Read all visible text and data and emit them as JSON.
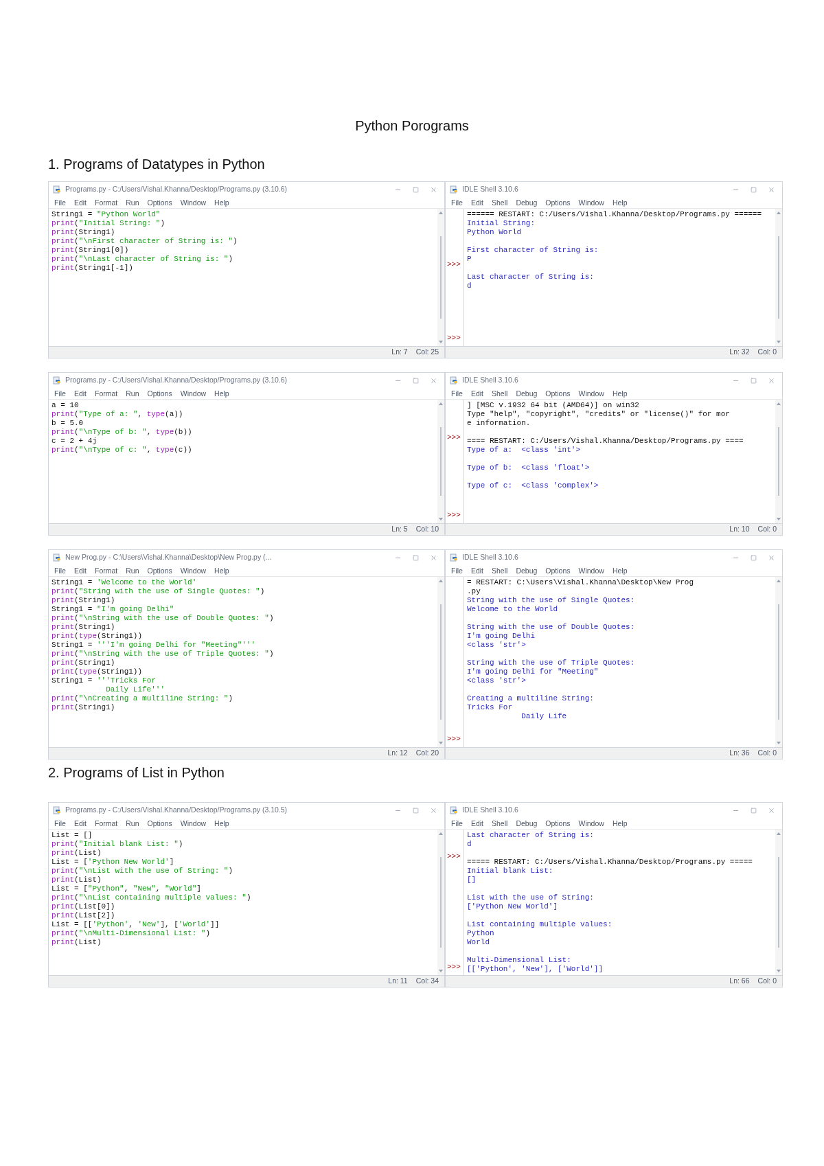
{
  "heading": "Python Porograms",
  "sections": [
    {
      "title": "1. Programs of Datatypes in Python",
      "rows": [
        {
          "editor": {
            "title": "Programs.py - C:/Users/Vishal.Khanna/Desktop/Programs.py (3.10.6)",
            "menu": [
              "File",
              "Edit",
              "Format",
              "Run",
              "Options",
              "Window",
              "Help"
            ],
            "lines": [
              [
                {
                  "kind": "plain",
                  "text": "String1 = "
                },
                {
                  "kind": "str",
                  "text": "\"Python World\""
                }
              ],
              [
                {
                  "kind": "kw",
                  "text": "print"
                },
                {
                  "kind": "plain",
                  "text": "("
                },
                {
                  "kind": "str",
                  "text": "\"Initial String: \""
                },
                {
                  "kind": "plain",
                  "text": ")"
                }
              ],
              [
                {
                  "kind": "kw",
                  "text": "print"
                },
                {
                  "kind": "plain",
                  "text": "(String1)"
                }
              ],
              [
                {
                  "kind": "kw",
                  "text": "print"
                },
                {
                  "kind": "plain",
                  "text": "("
                },
                {
                  "kind": "str",
                  "text": "\"\\nFirst character of String is: \""
                },
                {
                  "kind": "plain",
                  "text": ")"
                }
              ],
              [
                {
                  "kind": "kw",
                  "text": "print"
                },
                {
                  "kind": "plain",
                  "text": "(String1[0])"
                }
              ],
              [
                {
                  "kind": "kw",
                  "text": "print"
                },
                {
                  "kind": "plain",
                  "text": "("
                },
                {
                  "kind": "str",
                  "text": "\"\\nLast character of String is: \""
                },
                {
                  "kind": "plain",
                  "text": ")"
                }
              ],
              [
                {
                  "kind": "kw",
                  "text": "print"
                },
                {
                  "kind": "plain",
                  "text": "(String1[-1])"
                }
              ]
            ],
            "status": {
              "line": "Ln: 7",
              "col": "Col: 25"
            }
          },
          "shell": {
            "title": "IDLE Shell 3.10.6",
            "menu": [
              "File",
              "Edit",
              "Shell",
              "Debug",
              "Options",
              "Window",
              "Help"
            ],
            "lines": [
              {
                "kind": "restart",
                "text": "====== RESTART: C:/Users/Vishal.Khanna/Desktop/Programs.py ======"
              },
              {
                "kind": "output",
                "text": "Initial String:"
              },
              {
                "kind": "output",
                "text": "Python World"
              },
              {
                "kind": "blank"
              },
              {
                "kind": "output",
                "text": "First character of String is:"
              },
              {
                "kind": "output",
                "text": "P",
                "prompt": ">>>"
              },
              {
                "kind": "blank"
              },
              {
                "kind": "output",
                "text": "Last character of String is:"
              },
              {
                "kind": "output",
                "text": "d"
              }
            ],
            "final_prompt": ">>>",
            "status": {
              "line": "Ln: 32",
              "col": "Col: 0"
            }
          }
        },
        {
          "editor": {
            "title": "Programs.py - C:/Users/Vishal.Khanna/Desktop/Programs.py (3.10.6)",
            "menu": [
              "File",
              "Edit",
              "Format",
              "Run",
              "Options",
              "Window",
              "Help"
            ],
            "lines": [
              [
                {
                  "kind": "plain",
                  "text": "a = 10"
                }
              ],
              [
                {
                  "kind": "kw",
                  "text": "print"
                },
                {
                  "kind": "plain",
                  "text": "("
                },
                {
                  "kind": "str",
                  "text": "\"Type of a: \""
                },
                {
                  "kind": "plain",
                  "text": ", "
                },
                {
                  "kind": "kw",
                  "text": "type"
                },
                {
                  "kind": "plain",
                  "text": "(a))"
                }
              ],
              [
                {
                  "kind": "plain",
                  "text": "b = 5.0"
                }
              ],
              [
                {
                  "kind": "kw",
                  "text": "print"
                },
                {
                  "kind": "plain",
                  "text": "("
                },
                {
                  "kind": "str",
                  "text": "\"\\nType of b: \""
                },
                {
                  "kind": "plain",
                  "text": ", "
                },
                {
                  "kind": "kw",
                  "text": "type"
                },
                {
                  "kind": "plain",
                  "text": "(b))"
                }
              ],
              [
                {
                  "kind": "plain",
                  "text": "c = 2 + 4j"
                }
              ],
              [
                {
                  "kind": "kw",
                  "text": "print"
                },
                {
                  "kind": "plain",
                  "text": "("
                },
                {
                  "kind": "str",
                  "text": "\"\\nType of c: \""
                },
                {
                  "kind": "plain",
                  "text": ", "
                },
                {
                  "kind": "kw",
                  "text": "type"
                },
                {
                  "kind": "plain",
                  "text": "(c))"
                }
              ]
            ],
            "status": {
              "line": "Ln: 5",
              "col": "Col: 10"
            }
          },
          "shell": {
            "title": "IDLE Shell 3.10.6",
            "menu": [
              "File",
              "Edit",
              "Shell",
              "Debug",
              "Options",
              "Window",
              "Help"
            ],
            "lines": [
              {
                "kind": "info",
                "text": "] [MSC v.1932 64 bit (AMD64)] on win32"
              },
              {
                "kind": "info",
                "text": "Type \"help\", \"copyright\", \"credits\" or \"license()\" for mor"
              },
              {
                "kind": "info",
                "text": "e information."
              },
              {
                "kind": "blank",
                "prompt": ">>>"
              },
              {
                "kind": "restart",
                "text": "==== RESTART: C:/Users/Vishal.Khanna/Desktop/Programs.py ===="
              },
              {
                "kind": "output",
                "text": "Type of a:  <class 'int'>"
              },
              {
                "kind": "blank"
              },
              {
                "kind": "output",
                "text": "Type of b:  <class 'float'>"
              },
              {
                "kind": "blank"
              },
              {
                "kind": "output",
                "text": "Type of c:  <class 'complex'>"
              }
            ],
            "final_prompt": ">>>",
            "status": {
              "line": "Ln: 10",
              "col": "Col: 0"
            }
          }
        },
        {
          "editor": {
            "title": "New Prog.py - C:\\Users\\Vishal.Khanna\\Desktop\\New Prog.py (...",
            "menu": [
              "File",
              "Edit",
              "Format",
              "Run",
              "Options",
              "Window",
              "Help"
            ],
            "lines": [
              [
                {
                  "kind": "plain",
                  "text": "String1 = "
                },
                {
                  "kind": "str",
                  "text": "'Welcome to the World'"
                }
              ],
              [
                {
                  "kind": "kw",
                  "text": "print"
                },
                {
                  "kind": "plain",
                  "text": "("
                },
                {
                  "kind": "str",
                  "text": "\"String with the use of Single Quotes: \""
                },
                {
                  "kind": "plain",
                  "text": ")"
                }
              ],
              [
                {
                  "kind": "kw",
                  "text": "print"
                },
                {
                  "kind": "plain",
                  "text": "(String1)"
                }
              ],
              [
                {
                  "kind": "plain",
                  "text": "String1 = "
                },
                {
                  "kind": "str",
                  "text": "\"I'm going Delhi\""
                }
              ],
              [
                {
                  "kind": "kw",
                  "text": "print"
                },
                {
                  "kind": "plain",
                  "text": "("
                },
                {
                  "kind": "str",
                  "text": "\"\\nString with the use of Double Quotes: \""
                },
                {
                  "kind": "plain",
                  "text": ")"
                }
              ],
              [
                {
                  "kind": "kw",
                  "text": "print"
                },
                {
                  "kind": "plain",
                  "text": "(String1)"
                }
              ],
              [
                {
                  "kind": "kw",
                  "text": "print"
                },
                {
                  "kind": "plain",
                  "text": "("
                },
                {
                  "kind": "kw",
                  "text": "type"
                },
                {
                  "kind": "plain",
                  "text": "(String1))"
                }
              ],
              [
                {
                  "kind": "plain",
                  "text": "String1 = "
                },
                {
                  "kind": "str",
                  "text": "'''I'm going Delhi for \"Meeting\"'''"
                }
              ],
              [
                {
                  "kind": "kw",
                  "text": "print"
                },
                {
                  "kind": "plain",
                  "text": "("
                },
                {
                  "kind": "str",
                  "text": "\"\\nString with the use of Triple Quotes: \""
                },
                {
                  "kind": "plain",
                  "text": ")"
                }
              ],
              [
                {
                  "kind": "kw",
                  "text": "print"
                },
                {
                  "kind": "plain",
                  "text": "(String1)"
                }
              ],
              [
                {
                  "kind": "kw",
                  "text": "print"
                },
                {
                  "kind": "plain",
                  "text": "("
                },
                {
                  "kind": "kw",
                  "text": "type"
                },
                {
                  "kind": "plain",
                  "text": "(String1))"
                }
              ],
              [
                {
                  "kind": "plain",
                  "text": "String1 = "
                },
                {
                  "kind": "str",
                  "text": "'''Tricks For"
                }
              ],
              [
                {
                  "kind": "str",
                  "text": "            Daily Life'''"
                }
              ],
              [
                {
                  "kind": "kw",
                  "text": "print"
                },
                {
                  "kind": "plain",
                  "text": "("
                },
                {
                  "kind": "str",
                  "text": "\"\\nCreating a multiline String: \""
                },
                {
                  "kind": "plain",
                  "text": ")"
                }
              ],
              [
                {
                  "kind": "kw",
                  "text": "print"
                },
                {
                  "kind": "plain",
                  "text": "(String1)"
                }
              ]
            ],
            "status": {
              "line": "Ln: 12",
              "col": "Col: 20"
            }
          },
          "shell": {
            "title": "IDLE Shell 3.10.6",
            "menu": [
              "File",
              "Edit",
              "Shell",
              "Debug",
              "Options",
              "Window",
              "Help"
            ],
            "lines": [
              {
                "kind": "restart",
                "text": "= RESTART: C:\\Users\\Vishal.Khanna\\Desktop\\New Prog"
              },
              {
                "kind": "restart",
                "text": ".py"
              },
              {
                "kind": "output",
                "text": "String with the use of Single Quotes:"
              },
              {
                "kind": "output",
                "text": "Welcome to the World"
              },
              {
                "kind": "blank"
              },
              {
                "kind": "output",
                "text": "String with the use of Double Quotes:"
              },
              {
                "kind": "output",
                "text": "I'm going Delhi"
              },
              {
                "kind": "output",
                "text": "<class 'str'>"
              },
              {
                "kind": "blank"
              },
              {
                "kind": "output",
                "text": "String with the use of Triple Quotes:"
              },
              {
                "kind": "output",
                "text": "I'm going Delhi for \"Meeting\""
              },
              {
                "kind": "output",
                "text": "<class 'str'>"
              },
              {
                "kind": "blank"
              },
              {
                "kind": "output",
                "text": "Creating a multiline String:"
              },
              {
                "kind": "output",
                "text": "Tricks For"
              },
              {
                "kind": "output",
                "text": "            Daily Life"
              }
            ],
            "final_prompt": ">>>",
            "status": {
              "line": "Ln: 36",
              "col": "Col: 0"
            }
          }
        }
      ]
    },
    {
      "title": "2. Programs of List in Python",
      "rows": [
        {
          "editor": {
            "title": "Programs.py - C:/Users/Vishal.Khanna/Desktop/Programs.py (3.10.5)",
            "menu": [
              "File",
              "Edit",
              "Format",
              "Run",
              "Options",
              "Window",
              "Help"
            ],
            "lines": [
              [
                {
                  "kind": "plain",
                  "text": "List = []"
                }
              ],
              [
                {
                  "kind": "kw",
                  "text": "print"
                },
                {
                  "kind": "plain",
                  "text": "("
                },
                {
                  "kind": "str",
                  "text": "\"Initial blank List: \""
                },
                {
                  "kind": "plain",
                  "text": ")"
                }
              ],
              [
                {
                  "kind": "kw",
                  "text": "print"
                },
                {
                  "kind": "plain",
                  "text": "(List)"
                }
              ],
              [
                {
                  "kind": "plain",
                  "text": "List = ["
                },
                {
                  "kind": "str",
                  "text": "'Python New World'"
                },
                {
                  "kind": "plain",
                  "text": "]"
                }
              ],
              [
                {
                  "kind": "kw",
                  "text": "print"
                },
                {
                  "kind": "plain",
                  "text": "("
                },
                {
                  "kind": "str",
                  "text": "\"\\nList with the use of String: \""
                },
                {
                  "kind": "plain",
                  "text": ")"
                }
              ],
              [
                {
                  "kind": "kw",
                  "text": "print"
                },
                {
                  "kind": "plain",
                  "text": "(List)"
                }
              ],
              [
                {
                  "kind": "plain",
                  "text": "List = ["
                },
                {
                  "kind": "str",
                  "text": "\"Python\""
                },
                {
                  "kind": "plain",
                  "text": ", "
                },
                {
                  "kind": "str",
                  "text": "\"New\""
                },
                {
                  "kind": "plain",
                  "text": ", "
                },
                {
                  "kind": "str",
                  "text": "\"World\""
                },
                {
                  "kind": "plain",
                  "text": "]"
                }
              ],
              [
                {
                  "kind": "kw",
                  "text": "print"
                },
                {
                  "kind": "plain",
                  "text": "("
                },
                {
                  "kind": "str",
                  "text": "\"\\nList containing multiple values: \""
                },
                {
                  "kind": "plain",
                  "text": ")"
                }
              ],
              [
                {
                  "kind": "kw",
                  "text": "print"
                },
                {
                  "kind": "plain",
                  "text": "(List[0])"
                }
              ],
              [
                {
                  "kind": "kw",
                  "text": "print"
                },
                {
                  "kind": "plain",
                  "text": "(List[2])"
                }
              ],
              [
                {
                  "kind": "plain",
                  "text": "List = [["
                },
                {
                  "kind": "str",
                  "text": "'Python'"
                },
                {
                  "kind": "plain",
                  "text": ", "
                },
                {
                  "kind": "str",
                  "text": "'New'"
                },
                {
                  "kind": "plain",
                  "text": "], ["
                },
                {
                  "kind": "str",
                  "text": "'World'"
                },
                {
                  "kind": "plain",
                  "text": "]]"
                }
              ],
              [
                {
                  "kind": "kw",
                  "text": "print"
                },
                {
                  "kind": "plain",
                  "text": "("
                },
                {
                  "kind": "str",
                  "text": "\"\\nMulti-Dimensional List: \""
                },
                {
                  "kind": "plain",
                  "text": ")"
                }
              ],
              [
                {
                  "kind": "kw",
                  "text": "print"
                },
                {
                  "kind": "plain",
                  "text": "(List)"
                }
              ]
            ],
            "status": {
              "line": "Ln: 11",
              "col": "Col: 34"
            }
          },
          "shell": {
            "title": "IDLE Shell 3.10.6",
            "menu": [
              "File",
              "Edit",
              "Shell",
              "Debug",
              "Options",
              "Window",
              "Help"
            ],
            "lines": [
              {
                "kind": "output",
                "text": "Last character of String is:"
              },
              {
                "kind": "output",
                "text": "d"
              },
              {
                "kind": "blank",
                "prompt": ">>>"
              },
              {
                "kind": "restart",
                "text": "===== RESTART: C:/Users/Vishal.Khanna/Desktop/Programs.py ====="
              },
              {
                "kind": "output",
                "text": "Initial blank List:"
              },
              {
                "kind": "output",
                "text": "[]"
              },
              {
                "kind": "blank"
              },
              {
                "kind": "output",
                "text": "List with the use of String:"
              },
              {
                "kind": "output",
                "text": "['Python New World']"
              },
              {
                "kind": "blank"
              },
              {
                "kind": "output",
                "text": "List containing multiple values:"
              },
              {
                "kind": "output",
                "text": "Python"
              },
              {
                "kind": "output",
                "text": "World"
              },
              {
                "kind": "blank"
              },
              {
                "kind": "output",
                "text": "Multi-Dimensional List:"
              },
              {
                "kind": "output",
                "text": "[['Python', 'New'], ['World']]"
              }
            ],
            "final_prompt": ">>>",
            "status": {
              "line": "Ln: 66",
              "col": "Col: 0"
            }
          }
        }
      ]
    }
  ]
}
